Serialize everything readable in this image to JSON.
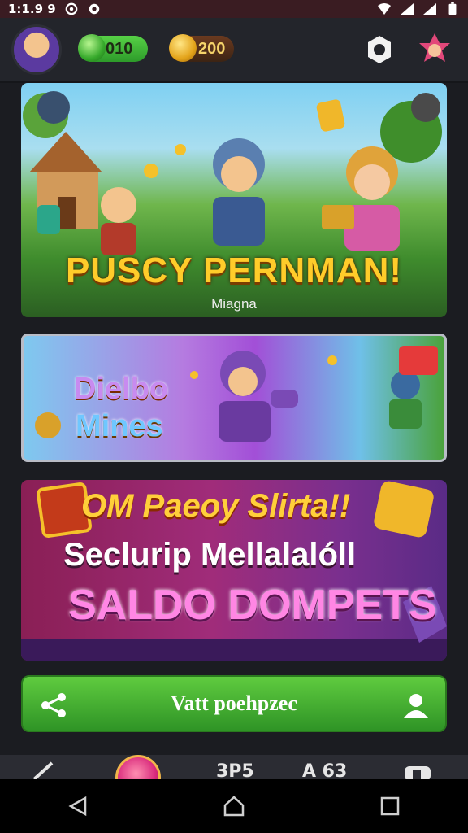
{
  "status_bar": {
    "time": "1:1.9 9"
  },
  "header": {
    "gems": "010",
    "coins": "200"
  },
  "cards": {
    "main": {
      "title": "PUSCY PERNMAN!",
      "subtitle": "Miagna"
    },
    "diablo": {
      "line1": "Dielbo",
      "line2": "Mines"
    },
    "promo": {
      "line1": "OM Paeoy Slirta!!",
      "line2": "Seclurip Mellalalóll",
      "line3": "SALDO DOMPETS"
    }
  },
  "cta": {
    "label": "Vatt poehpzec"
  },
  "bottom_nav": {
    "item3": "3P5",
    "item4": "A 63"
  },
  "colors": {
    "accent_green": "#3fb833",
    "coin_gold": "#f5c12a",
    "status_bar": "#3a1c22"
  }
}
